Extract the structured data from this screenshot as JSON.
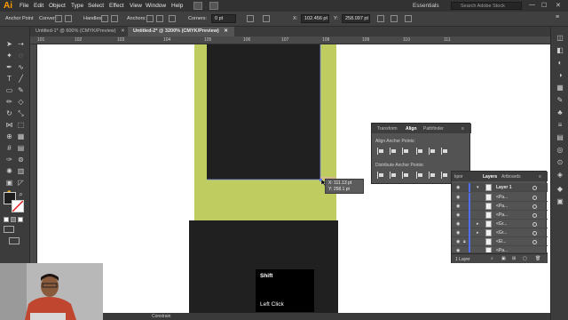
{
  "app": {
    "logo": "Ai",
    "menu": [
      "File",
      "Edit",
      "Object",
      "Type",
      "Select",
      "Effect",
      "View",
      "Window",
      "Help"
    ],
    "workspace": "Essentials",
    "stock_placeholder": "Search Adobe Stock",
    "window_controls": [
      "—",
      "☐",
      "✕"
    ]
  },
  "control_bar": {
    "anchor_point_label": "Anchor Point",
    "convert_label": "Convert:",
    "handles_label": "Handles:",
    "anchors_label": "Anchors:",
    "corners_label": "Corners:",
    "corners_value": "0 pt",
    "x_label": "X:",
    "x_value": "102.456 pt",
    "y_label": "Y:",
    "y_value": "258.097 pt"
  },
  "doc_tabs": [
    {
      "label": "Untitled-1* @ 600% (CMYK/Preview)",
      "close": "✕",
      "active": false
    },
    {
      "label": "Untitled-2* @ 3200% (CMYK/Preview)",
      "close": "✕",
      "active": true
    }
  ],
  "ruler": {
    "ticks": [
      "101",
      "102",
      "103",
      "104",
      "105",
      "106",
      "107",
      "108",
      "109",
      "110",
      "111"
    ]
  },
  "canvas": {
    "colors": {
      "green": "#bfcc5f",
      "dark": "#202020",
      "white": "#ffffff"
    }
  },
  "tooltip": {
    "x_line": "X: 111.13 pt",
    "y_line": "Y: 258.1 pt"
  },
  "align_panel": {
    "tabs": [
      "Transform",
      "Align",
      "Pathfinder"
    ],
    "active_tab": "Align",
    "section1": "Align Anchor Points:",
    "section2": "Distribute Anchor Points:",
    "menu_icon": "menu-icon"
  },
  "layers_panel": {
    "tabs": [
      "Layers",
      "Artboards"
    ],
    "cut_tab": "kpor",
    "rows": [
      {
        "name": "Layer 1",
        "top": true
      },
      {
        "name": "<Pa...",
        "top": false
      },
      {
        "name": "<Pa...",
        "top": false
      },
      {
        "name": "<Pa...",
        "top": false
      },
      {
        "name": "<Gr...",
        "top": false
      },
      {
        "name": "<Gr...",
        "top": false
      },
      {
        "name": "<El...",
        "top": false
      },
      {
        "name": "<Pa...",
        "top": false
      }
    ],
    "footer": "1 Layer"
  },
  "status_bar": {
    "label": "Constrain"
  },
  "shortcut_overlay": {
    "key1": "Shift",
    "key2": "Left Click"
  }
}
